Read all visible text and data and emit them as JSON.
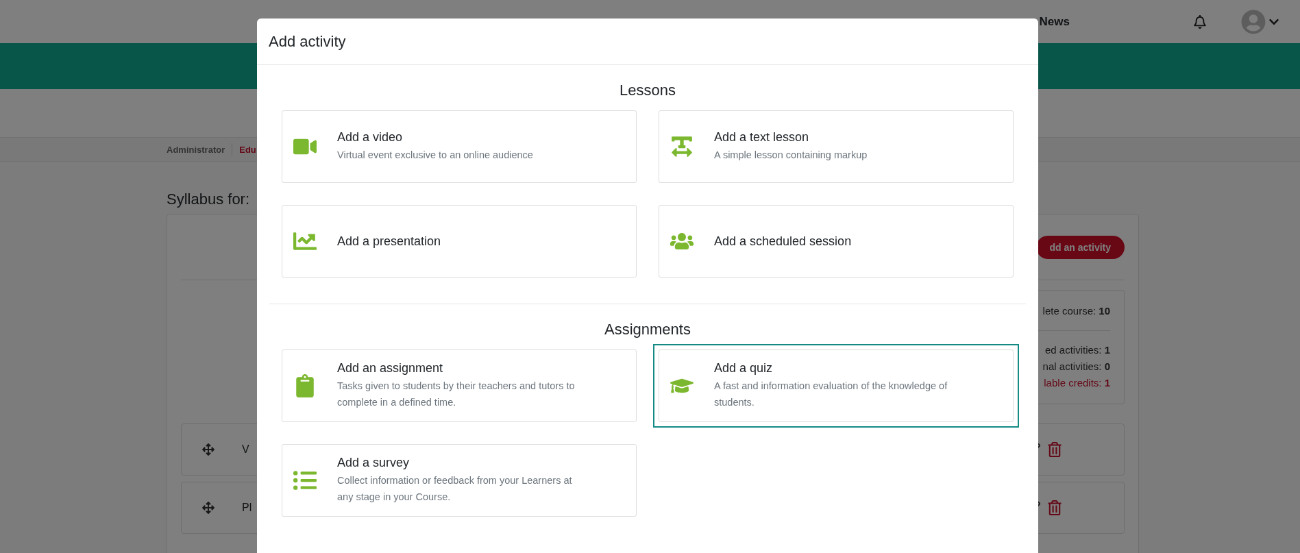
{
  "header": {
    "news": "News"
  },
  "breadcrumb": [
    {
      "label": "Administrator",
      "kind": "plain"
    },
    {
      "label": "Edu",
      "kind": "current"
    }
  ],
  "page_title": "Syllabus for:",
  "add_button": "dd an activity",
  "stats": [
    {
      "text": "lete course: **10**",
      "kind": "total"
    },
    {
      "text": "ed activities: **1**",
      "kind": "plain"
    },
    {
      "text": "nal activities: **0**",
      "kind": "plain"
    },
    {
      "text": "lable credits: **1**",
      "kind": "alert"
    }
  ],
  "rows": [
    {
      "label": "V"
    },
    {
      "label": "Pl"
    }
  ],
  "modal": {
    "title": "Add activity",
    "sections": [
      {
        "heading": "Lessons",
        "options": [
          {
            "kind": "video",
            "title": "Add a video",
            "description": "Virtual event exclusive to an online audience",
            "selected": false
          },
          {
            "kind": "text",
            "title": "Add a text lesson",
            "description": "A simple lesson containing markup",
            "selected": false
          },
          {
            "kind": "presentation",
            "title": "Add a presentation",
            "selected": false
          },
          {
            "kind": "session",
            "title": "Add a scheduled session",
            "selected": false
          }
        ]
      },
      {
        "heading": "Assignments",
        "options": [
          {
            "kind": "assignment",
            "title": "Add an assignment",
            "description": "Tasks given to students by their teachers and tutors to complete in a defined time.",
            "selected": false
          },
          {
            "kind": "quiz",
            "title": "Add a quiz",
            "description": "A fast and information evaluation of the knowledge of students.",
            "selected": true
          },
          {
            "kind": "survey",
            "title": "Add a survey",
            "description": "Collect information or feedback from your Learners at any stage in your Course.",
            "selected": false
          }
        ]
      }
    ]
  }
}
